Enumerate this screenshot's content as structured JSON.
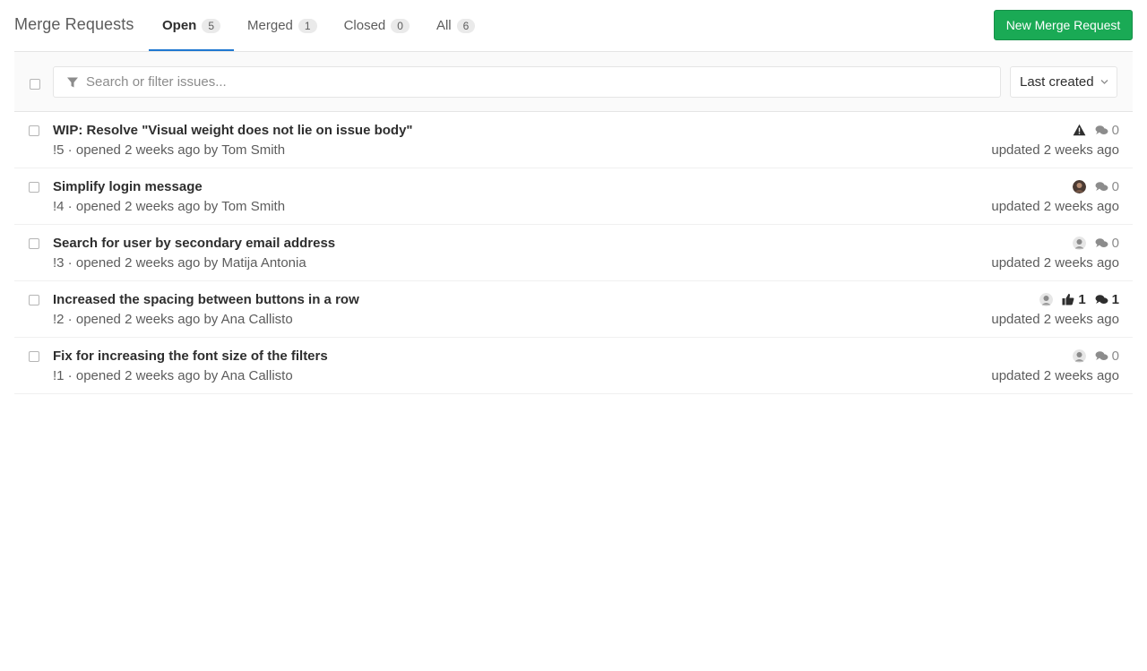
{
  "header": {
    "title": "Merge Requests",
    "new_button": "New Merge Request",
    "tabs": [
      {
        "label": "Open",
        "count": "5",
        "active": true
      },
      {
        "label": "Merged",
        "count": "1"
      },
      {
        "label": "Closed",
        "count": "0"
      },
      {
        "label": "All",
        "count": "6"
      }
    ]
  },
  "filter": {
    "placeholder": "Search or filter issues...",
    "sort_label": "Last created"
  },
  "items": [
    {
      "title": "WIP: Resolve \"Visual weight does not lie on issue body\"",
      "ref": "!5",
      "opened": " · opened 2 weeks ago by ",
      "author": "Tom Smith",
      "comments": "0",
      "updated": "updated 2 weeks ago"
    },
    {
      "title": "Simplify login message",
      "ref": "!4",
      "opened": " · opened 2 weeks ago by ",
      "author": "Tom Smith",
      "comments": "0",
      "updated": "updated 2 weeks ago"
    },
    {
      "title": "Search for user by secondary email address",
      "ref": "!3",
      "opened": " · opened 2 weeks ago by ",
      "author": "Matija Antonia",
      "comments": "0",
      "updated": "updated 2 weeks ago"
    },
    {
      "title": "Increased the spacing between buttons in a row",
      "ref": "!2",
      "opened": " · opened 2 weeks ago by ",
      "author": "Ana Callisto",
      "upvotes": "1",
      "comments": "1",
      "updated": "updated 2 weeks ago"
    },
    {
      "title": "Fix for increasing the font size of the filters",
      "ref": "!1",
      "opened": " · opened 2 weeks ago by ",
      "author": "Ana Callisto",
      "comments": "0",
      "updated": "updated 2 weeks ago"
    }
  ],
  "colors": {
    "accent": "#1aaa55",
    "active_tab": "#1f78d1"
  }
}
